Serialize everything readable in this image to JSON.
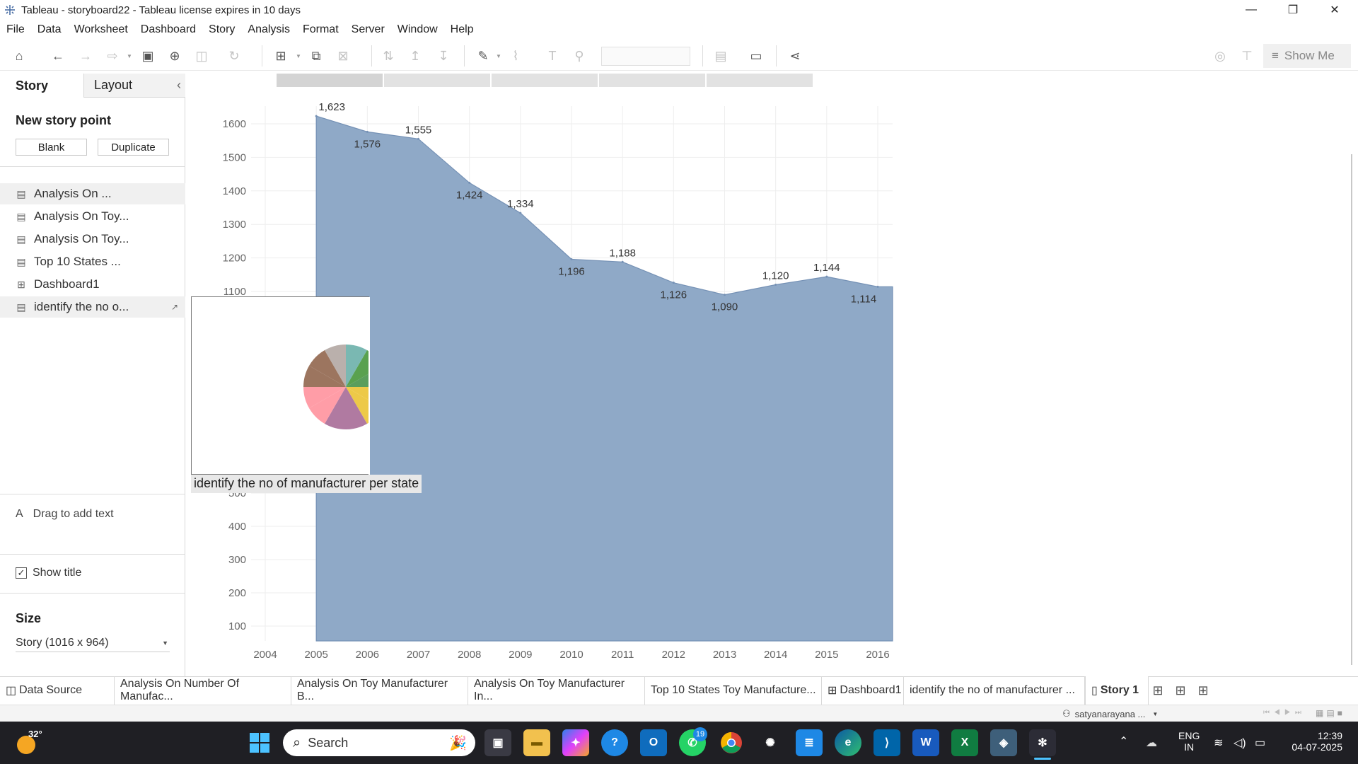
{
  "window": {
    "title": "Tableau - storyboard22 - Tableau license expires in 10 days",
    "minimize": "—",
    "restore": "❐",
    "close": "✕"
  },
  "menu": [
    "File",
    "Data",
    "Worksheet",
    "Dashboard",
    "Story",
    "Analysis",
    "Format",
    "Server",
    "Window",
    "Help"
  ],
  "toolbar": {
    "show_me": "Show Me"
  },
  "sidebar": {
    "tab_story": "Story",
    "tab_layout": "Layout",
    "collapse": "‹",
    "new_story_point": "New story point",
    "blank": "Blank",
    "duplicate": "Duplicate",
    "items": [
      {
        "label": "Analysis On ...",
        "icon": "worksheet-icon"
      },
      {
        "label": "Analysis On Toy...",
        "icon": "worksheet-icon"
      },
      {
        "label": "Analysis On Toy...",
        "icon": "worksheet-icon"
      },
      {
        "label": "Top 10 States ...",
        "icon": "worksheet-icon"
      },
      {
        "label": "Dashboard1",
        "icon": "dashboard-icon"
      },
      {
        "label": "identify the no o...",
        "icon": "worksheet-icon"
      }
    ],
    "drag_text_icon": "A",
    "drag_text": "Drag to add text",
    "show_title": "Show title",
    "show_title_checked": true,
    "size_heading": "Size",
    "size_value": "Story (1016 x 964)"
  },
  "chart_data": {
    "type": "area",
    "x": [
      2005,
      2006,
      2007,
      2008,
      2009,
      2010,
      2011,
      2012,
      2013,
      2014,
      2015,
      2016
    ],
    "values": [
      1623,
      1576,
      1555,
      1424,
      1334,
      1196,
      1188,
      1126,
      1090,
      1120,
      1144,
      1114
    ],
    "data_labels": [
      "1,623",
      "1,576",
      "1,555",
      "1,424",
      "1,334",
      "1,196",
      "1,188",
      "1,126",
      "1,090",
      "1,120",
      "1,144",
      "1,114"
    ],
    "x_ticks": [
      "2004",
      "2005",
      "2006",
      "2007",
      "2008",
      "2009",
      "2010",
      "2011",
      "2012",
      "2013",
      "2014",
      "2015",
      "2016"
    ],
    "y_ticks": [
      "100",
      "200",
      "300",
      "400",
      "500",
      "1100",
      "1200",
      "1300",
      "1400",
      "1500",
      "1600"
    ],
    "fill_color": "#8fa9c7",
    "line_color": "#7591b5",
    "grid": true
  },
  "overlay": {
    "caption": "identify the no of manufacturer per state",
    "pie_colors": [
      "#7ab8b2",
      "#59a14f",
      "#5a9e5c",
      "#edc948",
      "#b07aa1",
      "#ff9da7",
      "#9c755f",
      "#bab0ac"
    ]
  },
  "bottom_tabs": [
    {
      "label": "Data Source",
      "icon": "datasource-icon"
    },
    {
      "label": "Analysis On Number Of Manufac..."
    },
    {
      "label": "Analysis On Toy Manufacturer B..."
    },
    {
      "label": "Analysis On Toy Manufacturer In..."
    },
    {
      "label": "Top 10 States Toy Manufacture..."
    },
    {
      "label": "Dashboard1",
      "icon": "dashboard-icon"
    },
    {
      "label": "identify the no of manufacturer ..."
    },
    {
      "label": "Story 1",
      "icon": "story-icon",
      "active": true
    }
  ],
  "status": {
    "user": "satyanarayana ..."
  },
  "taskbar": {
    "weather": "32°",
    "search_placeholder": "Search",
    "whatsapp_badge": "19",
    "lang": "ENG",
    "region": "IN",
    "time": "12:39",
    "date": "04-07-2025"
  }
}
